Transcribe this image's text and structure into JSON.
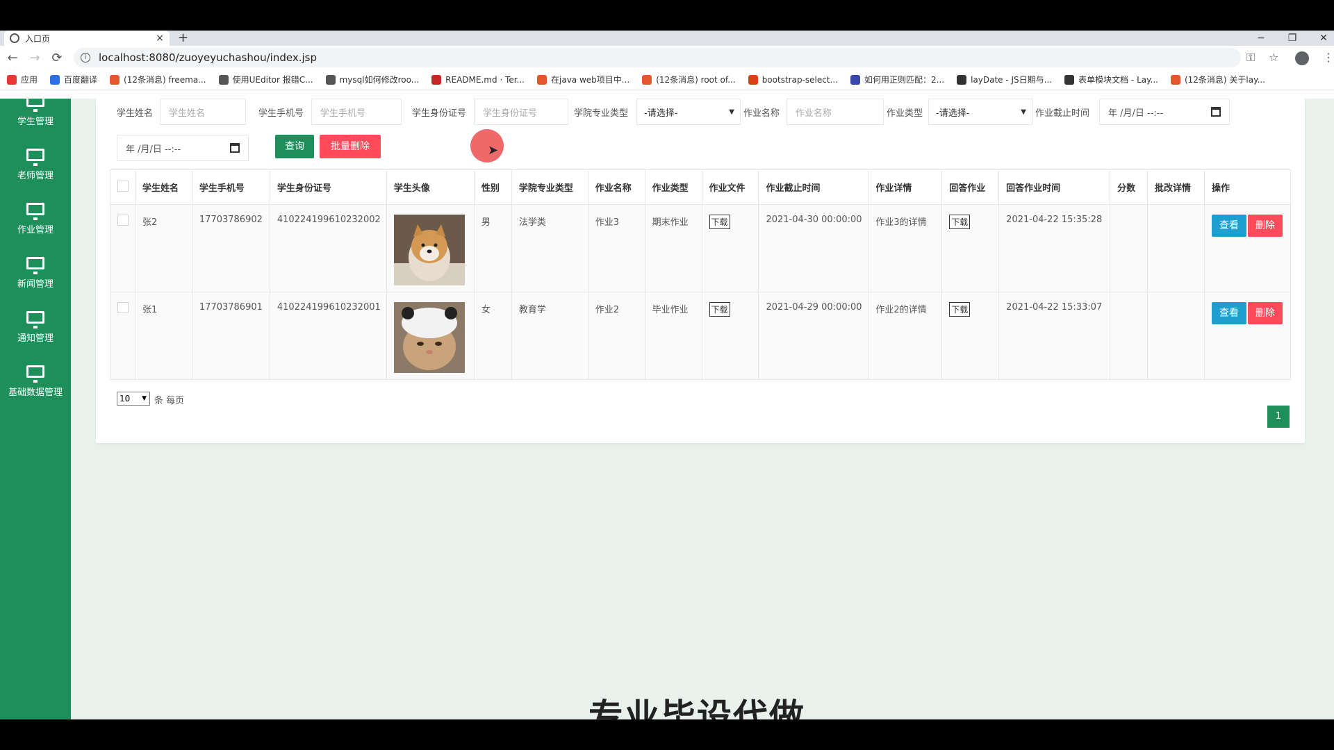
{
  "browser": {
    "tab_title": "入口页",
    "tab_close": "×",
    "new_tab": "+",
    "url": "localhost:8080/zuoyeyuchashou/index.jsp",
    "controls": {
      "minimize": "−",
      "restore": "❐",
      "close": "✕"
    },
    "nav": {
      "back": "←",
      "forward": "→",
      "reload": "⟳",
      "key": "⚿",
      "star": "☆",
      "menu": "⋮"
    },
    "bookmarks": [
      {
        "label": "应用",
        "color": "#e53935"
      },
      {
        "label": "百度翻译",
        "color": "#2d6fe0"
      },
      {
        "label": "(12条消息) freema...",
        "color": "#e4572e"
      },
      {
        "label": "使用UEditor 报错C...",
        "color": "#555555"
      },
      {
        "label": "mysql如何修改roo...",
        "color": "#555555"
      },
      {
        "label": "README.md · Ter...",
        "color": "#c62828"
      },
      {
        "label": "在java web项目中...",
        "color": "#e4572e"
      },
      {
        "label": "(12条消息) root of...",
        "color": "#e4572e"
      },
      {
        "label": "bootstrap-select...",
        "color": "#d84315"
      },
      {
        "label": "如何用正则匹配：2...",
        "color": "#3949ab"
      },
      {
        "label": "layDate - JS日期与...",
        "color": "#333333"
      },
      {
        "label": "表单模块文档 - Lay...",
        "color": "#333333"
      },
      {
        "label": "(12条消息) 关于lay...",
        "color": "#e4572e"
      }
    ]
  },
  "sidebar": {
    "items": [
      {
        "label": "学生管理"
      },
      {
        "label": "老师管理"
      },
      {
        "label": "作业管理"
      },
      {
        "label": "新闻管理"
      },
      {
        "label": "通知管理"
      },
      {
        "label": "基础数据管理"
      }
    ]
  },
  "filters": {
    "student_name": {
      "label": "学生姓名",
      "placeholder": "学生姓名"
    },
    "student_phone": {
      "label": "学生手机号",
      "placeholder": "学生手机号"
    },
    "student_id": {
      "label": "学生身份证号",
      "placeholder": "学生身份证号"
    },
    "major_type": {
      "label": "学院专业类型",
      "value": "-请选择-"
    },
    "hw_name": {
      "label": "作业名称",
      "placeholder": "作业名称"
    },
    "hw_type": {
      "label": "作业类型",
      "value": "-请选择-"
    },
    "deadline": {
      "label": "作业截止时间",
      "value": "年 /月/日 --:--"
    },
    "deadline2": {
      "value": "年 /月/日 --:--"
    },
    "query_button": "查询",
    "batch_delete_button": "批量删除"
  },
  "table": {
    "headers": [
      "学生姓名",
      "学生手机号",
      "学生身份证号",
      "学生头像",
      "性别",
      "学院专业类型",
      "作业名称",
      "作业类型",
      "作业文件",
      "作业截止时间",
      "作业详情",
      "回答作业",
      "回答作业时间",
      "分数",
      "批改详情",
      "操作"
    ],
    "rows": [
      {
        "name": "张2",
        "phone": "17703786902",
        "idcard": "410224199610232002",
        "avatar": "shiba-dog",
        "gender": "男",
        "major": "法学类",
        "hw_name": "作业3",
        "hw_type": "期末作业",
        "file": "下载",
        "deadline": "2021-04-30 00:00:00",
        "detail": "作业3的详情",
        "answer": "下载",
        "answer_time": "2021-04-22 15:35:28",
        "score": "",
        "review": "",
        "view": "查看",
        "delete": "删除"
      },
      {
        "name": "张1",
        "phone": "17703786901",
        "idcard": "410224199610232001",
        "avatar": "cat-in-hat",
        "gender": "女",
        "major": "教育学",
        "hw_name": "作业2",
        "hw_type": "毕业作业",
        "file": "下载",
        "deadline": "2021-04-29 00:00:00",
        "detail": "作业2的详情",
        "answer": "下载",
        "answer_time": "2021-04-22 15:33:07",
        "score": "",
        "review": "",
        "view": "查看",
        "delete": "删除"
      }
    ]
  },
  "pagination": {
    "page_size": "10",
    "page_size_label": "条 每页",
    "current_page": "1"
  },
  "overlay_caption": "专业毕设代做",
  "colors": {
    "primary": "#1e8f5b",
    "danger": "#ff4a5b",
    "info": "#1e9fcf",
    "sidebar": "#1e8f5b",
    "background": "#e8f1ec"
  }
}
